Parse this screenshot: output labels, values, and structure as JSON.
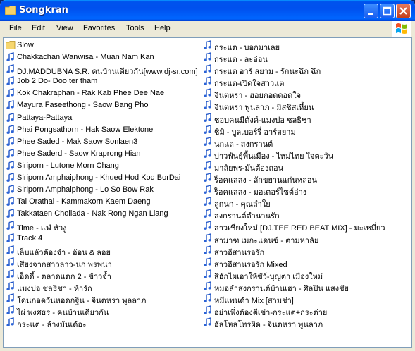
{
  "window": {
    "title": "Songkran"
  },
  "menu": [
    "File",
    "Edit",
    "View",
    "Favorites",
    "Tools",
    "Help"
  ],
  "files_col1": [
    {
      "label": "Slow",
      "type": "folder"
    },
    {
      "label": "Chakkachan Wanwisa - Muan Nam Kan",
      "type": "audio"
    },
    {
      "label": "DJ.MADDUBNA S.R. คนบ้านเดียวกัน[www.dj-sr.com]",
      "type": "audio"
    },
    {
      "label": "Job 2 Do- Doo ter tham",
      "type": "audio"
    },
    {
      "label": "Kok Chakraphan - Rak Kab Phee Dee Nae",
      "type": "audio"
    },
    {
      "label": "Mayura Faseethong - Saow Bang Pho",
      "type": "audio"
    },
    {
      "label": "Pattaya-Pattaya",
      "type": "audio"
    },
    {
      "label": "Phai Pongsathorn - Hak Saow Elektone",
      "type": "audio"
    },
    {
      "label": "Phee Saded - Mak Saow Sonlaen3",
      "type": "audio"
    },
    {
      "label": "Phee Saderd - Saow Kraprong Hian",
      "type": "audio"
    },
    {
      "label": "Siriporn - Lutone Morn Chang",
      "type": "audio"
    },
    {
      "label": "Siriporn Amphaiphong - Khued Hod Kod BorDai",
      "type": "audio"
    },
    {
      "label": "Siriporn Amphaiphong - Lo So Bow Rak",
      "type": "audio"
    },
    {
      "label": "Tai Orathai - Kammakorn Kaem Daeng",
      "type": "audio"
    },
    {
      "label": "Takkataen Chollada - Nak Rong Ngan Liang",
      "type": "audio"
    },
    {
      "label": "Time - แฟ่ หัวงู",
      "type": "audio"
    },
    {
      "label": "Track 4",
      "type": "audio"
    },
    {
      "label": "เล็บแล้วต้องจำ - อ้อน & ลอย",
      "type": "audio"
    },
    {
      "label": "เสียงจากสาวลาว-นก พรพนา",
      "type": "audio"
    },
    {
      "label": "เอ็ดดี้ - ตลาดแตก 2 - ข้าวจ้ำ",
      "type": "audio"
    },
    {
      "label": "แมงปอ ชลธิชา - ห้ารัก",
      "type": "audio"
    },
    {
      "label": "โดนกอดวันหอดกฐิน - จินตหรา พูลลาภ",
      "type": "audio"
    },
    {
      "label": "ไผ่ พงศธร - คนบ้านเดียวกัน",
      "type": "audio"
    },
    {
      "label": "กระแต - ล้างมันเด้อะ",
      "type": "audio"
    }
  ],
  "files_col2": [
    {
      "label": "กระแต - บอกมาเลย",
      "type": "audio"
    },
    {
      "label": "กระแต - ละอ่อน",
      "type": "audio"
    },
    {
      "label": "กระแต อาร์ สยาม - รักนะฉึก ฉึก",
      "type": "audio"
    },
    {
      "label": "กระแต-เปิดใจสาวแต",
      "type": "audio"
    },
    {
      "label": "จินตหรา - ฮอยกอดดอดใจ",
      "type": "audio"
    },
    {
      "label": "จินตหรา พูนลาภ - มิสชิสเหี้ยน",
      "type": "audio"
    },
    {
      "label": "ชอบคนมีตังค์-แมงปอ ชลธิชา",
      "type": "audio"
    },
    {
      "label": "ชิมิ - บูลเบอร์รี่ อาร์สยาม",
      "type": "audio"
    },
    {
      "label": "นกแล - สงกรานต์",
      "type": "audio"
    },
    {
      "label": "บ่าวพันธุ์พื้นเมือง - ไหม่ไทย ใจตะวัน",
      "type": "audio"
    },
    {
      "label": "มาลัยพร-มันต้องถอน",
      "type": "audio"
    },
    {
      "label": "ร็อคแสลง - ลักขยานแก่นหล่อน",
      "type": "audio"
    },
    {
      "label": "ร็อคแสลง - มอเตอร์ไซต์อ่าง",
      "type": "audio"
    },
    {
      "label": "ลูกนก - คุณลำใย",
      "type": "audio"
    },
    {
      "label": "สงกรานต์ตำนานรัก",
      "type": "audio"
    },
    {
      "label": "สาวเชียงใหม่ [DJ.TEE RED BEAT MIX] - มะเหมี่ยว",
      "type": "audio"
    },
    {
      "label": "สามาฑ เมกะแดนซ์ - ตามหาลัย",
      "type": "audio"
    },
    {
      "label": "สาวอีสานรอรัก",
      "type": "audio"
    },
    {
      "label": "สาวอีสานรอรัก Mixed",
      "type": "audio"
    },
    {
      "label": "สิฮักไผเอาให้ซัว์-บุญตา เมืองใหม่",
      "type": "audio"
    },
    {
      "label": "หมอลำสงกรานต์บ้านเฮา - ศิลปิน แสงชัย",
      "type": "audio"
    },
    {
      "label": "หมีแพนด้า Mix [สามช่า]",
      "type": "audio"
    },
    {
      "label": "อย่าเพิ่งต้องตีเข่า-กระแต+กระต่าย",
      "type": "audio"
    },
    {
      "label": "อัลโหลโทรผิด - จินตหรา พูนลาภ",
      "type": "audio"
    }
  ]
}
